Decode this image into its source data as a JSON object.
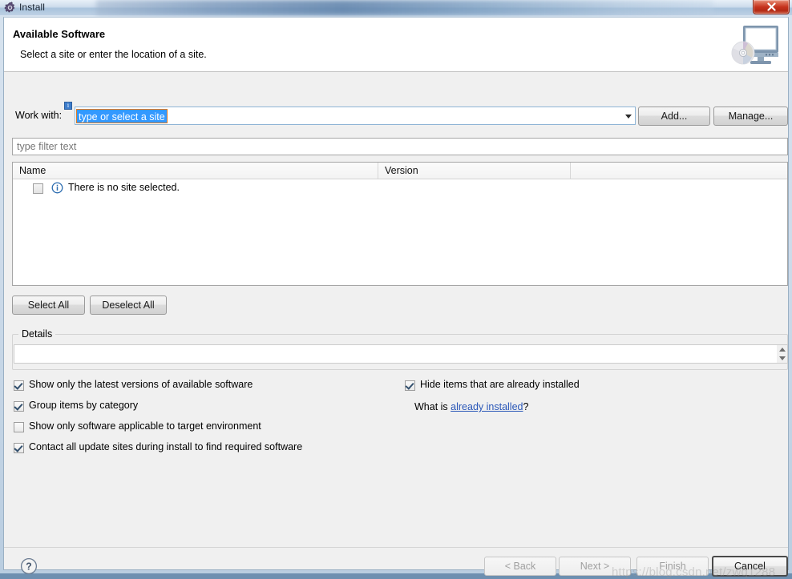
{
  "window": {
    "title": "Install",
    "title_icon": "gear-icon",
    "close_label": "✕"
  },
  "header": {
    "title": "Available Software",
    "subtitle": "Select a site or enter the location of a site.",
    "icon": "monitor-cd-icon"
  },
  "work_with": {
    "label": "Work with:",
    "value": "type or select a site",
    "info_badge": "i",
    "add_label": "Add...",
    "manage_label": "Manage..."
  },
  "filter": {
    "placeholder": "type filter text",
    "value": ""
  },
  "table": {
    "columns": [
      "Name",
      "Version",
      ""
    ],
    "rows": [
      {
        "checked": false,
        "icon": "info-circle-icon",
        "name": "There is no site selected.",
        "version": ""
      }
    ]
  },
  "list_actions": {
    "select_all": "Select All",
    "deselect_all": "Deselect All"
  },
  "details": {
    "legend": "Details",
    "content": ""
  },
  "options": {
    "left": [
      {
        "label": "Show only the latest versions of available software",
        "checked": true
      },
      {
        "label": "Group items by category",
        "checked": true
      },
      {
        "label": "Show only software applicable to target environment",
        "checked": false
      },
      {
        "label": "Contact all update sites during install to find required software",
        "checked": true
      }
    ],
    "right": [
      {
        "label": "Hide items that are already installed",
        "checked": true
      }
    ],
    "what_is_prefix": "What is ",
    "what_is_link": "already installed",
    "what_is_suffix": "?"
  },
  "footer": {
    "help": "?",
    "back": "< Back",
    "next": "Next >",
    "finish": "Finish",
    "cancel": "Cancel"
  },
  "watermark": "https://blog.csdn.net/zwq1288",
  "colors": {
    "selection_blue": "#3399ff",
    "link_blue": "#2a57b8",
    "close_red": "#c5321d",
    "info_blue": "#3d7dcc"
  }
}
